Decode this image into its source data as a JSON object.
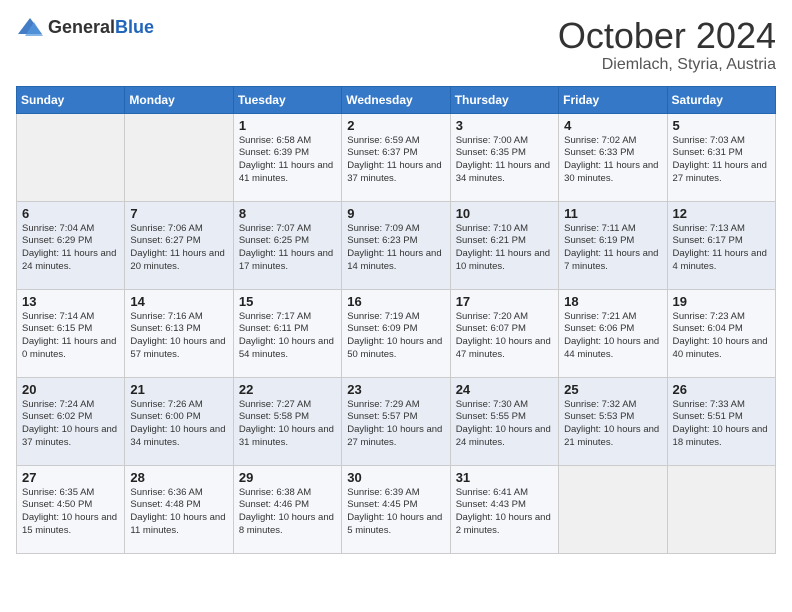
{
  "header": {
    "logo_general": "General",
    "logo_blue": "Blue",
    "month": "October 2024",
    "location": "Diemlach, Styria, Austria"
  },
  "weekdays": [
    "Sunday",
    "Monday",
    "Tuesday",
    "Wednesday",
    "Thursday",
    "Friday",
    "Saturday"
  ],
  "weeks": [
    [
      {
        "day": "",
        "sunrise": "",
        "sunset": "",
        "daylight": ""
      },
      {
        "day": "",
        "sunrise": "",
        "sunset": "",
        "daylight": ""
      },
      {
        "day": "1",
        "sunrise": "Sunrise: 6:58 AM",
        "sunset": "Sunset: 6:39 PM",
        "daylight": "Daylight: 11 hours and 41 minutes."
      },
      {
        "day": "2",
        "sunrise": "Sunrise: 6:59 AM",
        "sunset": "Sunset: 6:37 PM",
        "daylight": "Daylight: 11 hours and 37 minutes."
      },
      {
        "day": "3",
        "sunrise": "Sunrise: 7:00 AM",
        "sunset": "Sunset: 6:35 PM",
        "daylight": "Daylight: 11 hours and 34 minutes."
      },
      {
        "day": "4",
        "sunrise": "Sunrise: 7:02 AM",
        "sunset": "Sunset: 6:33 PM",
        "daylight": "Daylight: 11 hours and 30 minutes."
      },
      {
        "day": "5",
        "sunrise": "Sunrise: 7:03 AM",
        "sunset": "Sunset: 6:31 PM",
        "daylight": "Daylight: 11 hours and 27 minutes."
      }
    ],
    [
      {
        "day": "6",
        "sunrise": "Sunrise: 7:04 AM",
        "sunset": "Sunset: 6:29 PM",
        "daylight": "Daylight: 11 hours and 24 minutes."
      },
      {
        "day": "7",
        "sunrise": "Sunrise: 7:06 AM",
        "sunset": "Sunset: 6:27 PM",
        "daylight": "Daylight: 11 hours and 20 minutes."
      },
      {
        "day": "8",
        "sunrise": "Sunrise: 7:07 AM",
        "sunset": "Sunset: 6:25 PM",
        "daylight": "Daylight: 11 hours and 17 minutes."
      },
      {
        "day": "9",
        "sunrise": "Sunrise: 7:09 AM",
        "sunset": "Sunset: 6:23 PM",
        "daylight": "Daylight: 11 hours and 14 minutes."
      },
      {
        "day": "10",
        "sunrise": "Sunrise: 7:10 AM",
        "sunset": "Sunset: 6:21 PM",
        "daylight": "Daylight: 11 hours and 10 minutes."
      },
      {
        "day": "11",
        "sunrise": "Sunrise: 7:11 AM",
        "sunset": "Sunset: 6:19 PM",
        "daylight": "Daylight: 11 hours and 7 minutes."
      },
      {
        "day": "12",
        "sunrise": "Sunrise: 7:13 AM",
        "sunset": "Sunset: 6:17 PM",
        "daylight": "Daylight: 11 hours and 4 minutes."
      }
    ],
    [
      {
        "day": "13",
        "sunrise": "Sunrise: 7:14 AM",
        "sunset": "Sunset: 6:15 PM",
        "daylight": "Daylight: 11 hours and 0 minutes."
      },
      {
        "day": "14",
        "sunrise": "Sunrise: 7:16 AM",
        "sunset": "Sunset: 6:13 PM",
        "daylight": "Daylight: 10 hours and 57 minutes."
      },
      {
        "day": "15",
        "sunrise": "Sunrise: 7:17 AM",
        "sunset": "Sunset: 6:11 PM",
        "daylight": "Daylight: 10 hours and 54 minutes."
      },
      {
        "day": "16",
        "sunrise": "Sunrise: 7:19 AM",
        "sunset": "Sunset: 6:09 PM",
        "daylight": "Daylight: 10 hours and 50 minutes."
      },
      {
        "day": "17",
        "sunrise": "Sunrise: 7:20 AM",
        "sunset": "Sunset: 6:07 PM",
        "daylight": "Daylight: 10 hours and 47 minutes."
      },
      {
        "day": "18",
        "sunrise": "Sunrise: 7:21 AM",
        "sunset": "Sunset: 6:06 PM",
        "daylight": "Daylight: 10 hours and 44 minutes."
      },
      {
        "day": "19",
        "sunrise": "Sunrise: 7:23 AM",
        "sunset": "Sunset: 6:04 PM",
        "daylight": "Daylight: 10 hours and 40 minutes."
      }
    ],
    [
      {
        "day": "20",
        "sunrise": "Sunrise: 7:24 AM",
        "sunset": "Sunset: 6:02 PM",
        "daylight": "Daylight: 10 hours and 37 minutes."
      },
      {
        "day": "21",
        "sunrise": "Sunrise: 7:26 AM",
        "sunset": "Sunset: 6:00 PM",
        "daylight": "Daylight: 10 hours and 34 minutes."
      },
      {
        "day": "22",
        "sunrise": "Sunrise: 7:27 AM",
        "sunset": "Sunset: 5:58 PM",
        "daylight": "Daylight: 10 hours and 31 minutes."
      },
      {
        "day": "23",
        "sunrise": "Sunrise: 7:29 AM",
        "sunset": "Sunset: 5:57 PM",
        "daylight": "Daylight: 10 hours and 27 minutes."
      },
      {
        "day": "24",
        "sunrise": "Sunrise: 7:30 AM",
        "sunset": "Sunset: 5:55 PM",
        "daylight": "Daylight: 10 hours and 24 minutes."
      },
      {
        "day": "25",
        "sunrise": "Sunrise: 7:32 AM",
        "sunset": "Sunset: 5:53 PM",
        "daylight": "Daylight: 10 hours and 21 minutes."
      },
      {
        "day": "26",
        "sunrise": "Sunrise: 7:33 AM",
        "sunset": "Sunset: 5:51 PM",
        "daylight": "Daylight: 10 hours and 18 minutes."
      }
    ],
    [
      {
        "day": "27",
        "sunrise": "Sunrise: 6:35 AM",
        "sunset": "Sunset: 4:50 PM",
        "daylight": "Daylight: 10 hours and 15 minutes."
      },
      {
        "day": "28",
        "sunrise": "Sunrise: 6:36 AM",
        "sunset": "Sunset: 4:48 PM",
        "daylight": "Daylight: 10 hours and 11 minutes."
      },
      {
        "day": "29",
        "sunrise": "Sunrise: 6:38 AM",
        "sunset": "Sunset: 4:46 PM",
        "daylight": "Daylight: 10 hours and 8 minutes."
      },
      {
        "day": "30",
        "sunrise": "Sunrise: 6:39 AM",
        "sunset": "Sunset: 4:45 PM",
        "daylight": "Daylight: 10 hours and 5 minutes."
      },
      {
        "day": "31",
        "sunrise": "Sunrise: 6:41 AM",
        "sunset": "Sunset: 4:43 PM",
        "daylight": "Daylight: 10 hours and 2 minutes."
      },
      {
        "day": "",
        "sunrise": "",
        "sunset": "",
        "daylight": ""
      },
      {
        "day": "",
        "sunrise": "",
        "sunset": "",
        "daylight": ""
      }
    ]
  ]
}
